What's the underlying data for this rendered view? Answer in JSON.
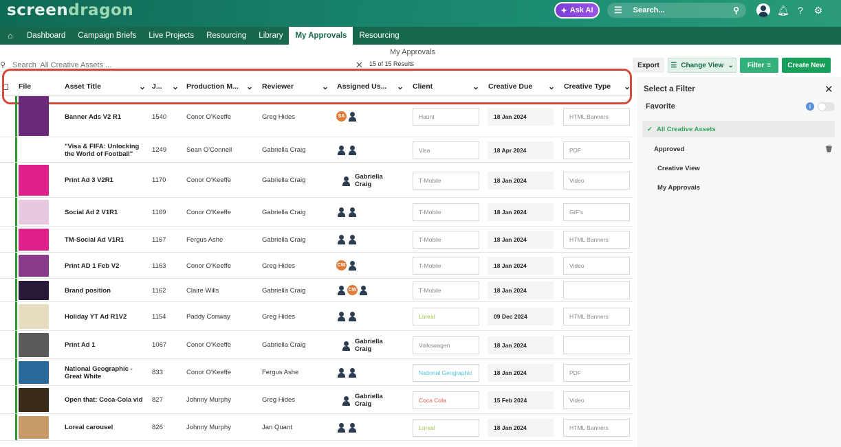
{
  "app": {
    "logo_part1": "screen",
    "logo_part2": "dragon",
    "ask_ai": "Ask AI",
    "search_placeholder": "Search..."
  },
  "nav": {
    "items": [
      {
        "label": "Dashboard"
      },
      {
        "label": "Campaign Briefs"
      },
      {
        "label": "Live Projects"
      },
      {
        "label": "Resourcing"
      },
      {
        "label": "Library"
      },
      {
        "label": "My Approvals"
      },
      {
        "label": "Resourcing"
      }
    ],
    "active": "My Approvals"
  },
  "page": {
    "title": "My Approvals",
    "search_placeholder": "Search  All Creative Assets ...",
    "results": "15 of 15 Results"
  },
  "actions": {
    "export": "Export",
    "change_view": "Change View",
    "filter": "Filter",
    "create_new": "Create New"
  },
  "table": {
    "columns": [
      "File",
      "Asset Title",
      "J...",
      "Production M...",
      "Reviewer",
      "Assigned Us...",
      "Client",
      "Creative Due",
      "Creative Type"
    ],
    "rows": [
      {
        "title": "Banner Ads V2 R1",
        "job": "1540",
        "pm": "Conor O'Keeffe",
        "reviewer": "Greg Hides",
        "users": [
          "SA",
          "icon"
        ],
        "client": "Haunt",
        "client_color": "#888888",
        "due": "18 Jan 2024",
        "type": "HTML Banners",
        "thumb": "#6a2a7a"
      },
      {
        "title": "\"Visa & FIFA: Unlocking the World of Football\"",
        "job": "1249",
        "pm": "Sean O'Connell",
        "reviewer": "Gabriella Craig",
        "users": [
          "icon",
          "icon"
        ],
        "client": "Visa",
        "client_color": "#888888",
        "due": "18 Apr 2024",
        "type": "PDF",
        "thumb": "#ffffff"
      },
      {
        "title": "Print Ad 3 V2R1",
        "job": "1170",
        "pm": "Conor O'Keeffe",
        "reviewer": "Gabriella Craig",
        "users": [
          "icon"
        ],
        "user_name": "Gabriella Craig",
        "client": "T-Mobile",
        "client_color": "#888888",
        "due": "18 Jan 2024",
        "type": "Video",
        "thumb": "#e0208a"
      },
      {
        "title": "Social Ad 2 V1R1",
        "job": "1169",
        "pm": "Conor O'Keeffe",
        "reviewer": "Gabriella Craig",
        "users": [
          "icon",
          "icon"
        ],
        "client": "T-Mobile",
        "client_color": "#888888",
        "due": "18 Jan 2024",
        "type": "GIF's",
        "thumb": "#e8c8e0"
      },
      {
        "title": "TM-Social Ad V1R1",
        "job": "1167",
        "pm": "Fergus Ashe",
        "reviewer": "Gabriella Craig",
        "users": [
          "icon",
          "icon"
        ],
        "client": "T-Mobile",
        "client_color": "#888888",
        "due": "18 Jan 2024",
        "type": "HTML Banners",
        "thumb": "#e0208a"
      },
      {
        "title": "Print AD 1 Feb V2",
        "job": "1163",
        "pm": "Conor O'Keeffe",
        "reviewer": "Greg Hides",
        "users": [
          "CW",
          "icon"
        ],
        "client": "T-Mobile",
        "client_color": "#888888",
        "due": "18 Jan 2024",
        "type": "Video",
        "thumb": "#8a3a8a"
      },
      {
        "title": "Brand position",
        "job": "1162",
        "pm": "Claire Wills",
        "reviewer": "Gabriella Craig",
        "users": [
          "icon",
          "CW",
          "icon"
        ],
        "client": "T-Mobile",
        "client_color": "#888888",
        "due": "18 Jan 2024",
        "type": "",
        "thumb": "#2a1a3a"
      },
      {
        "title": "Holiday YT Ad R1V2",
        "job": "1154",
        "pm": "Paddy Conway",
        "reviewer": "Greg Hides",
        "users": [
          "icon",
          "icon"
        ],
        "client": "Loreal",
        "client_color": "#9cc34a",
        "due": "09 Dec 2024",
        "type": "HTML Banners",
        "thumb": "#e8dcc0"
      },
      {
        "title": "Print Ad 1",
        "job": "1067",
        "pm": "Conor O'Keeffe",
        "reviewer": "Gabriella Craig",
        "users": [
          "icon"
        ],
        "user_name": "Gabriella Craig",
        "client": "Volkswagen",
        "client_color": "#888888",
        "due": "18 Jan 2024",
        "type": "",
        "thumb": "#5a5a5a"
      },
      {
        "title": "National Geographic - Great White",
        "job": "833",
        "pm": "Conor O'Keeffe",
        "reviewer": "Fergus Ashe",
        "users": [
          "icon",
          "icon"
        ],
        "client": "National Geographic",
        "client_color": "#4fc3d9",
        "due": "18 Jan 2024",
        "type": "PDF",
        "thumb": "#2a6a9a"
      },
      {
        "title": "Open that: Coca-Cola vid",
        "job": "827",
        "pm": "Johnny Murphy",
        "reviewer": "Greg Hides",
        "users": [
          "icon"
        ],
        "user_name": "Gabriella Craig",
        "client": "Coca Cola",
        "client_color": "#e05545",
        "due": "15 Feb 2024",
        "type": "Video",
        "thumb": "#3a2a1a"
      },
      {
        "title": "Loreal carousel",
        "job": "826",
        "pm": "Johnny Murphy",
        "reviewer": "Jan Quant",
        "users": [
          "icon",
          "icon"
        ],
        "client": "Loreal",
        "client_color": "#9cc34a",
        "due": "18 Jan 2024",
        "type": "HTML Banners",
        "thumb": "#c89a6a"
      }
    ]
  },
  "filter_panel": {
    "title": "Select a Filter",
    "favorite": "Favorite",
    "items": [
      {
        "label": "All Creative Assets",
        "selected": true
      },
      {
        "label": "Approved",
        "trash": true
      },
      {
        "label": "Creative View"
      },
      {
        "label": "My Approvals"
      }
    ]
  }
}
